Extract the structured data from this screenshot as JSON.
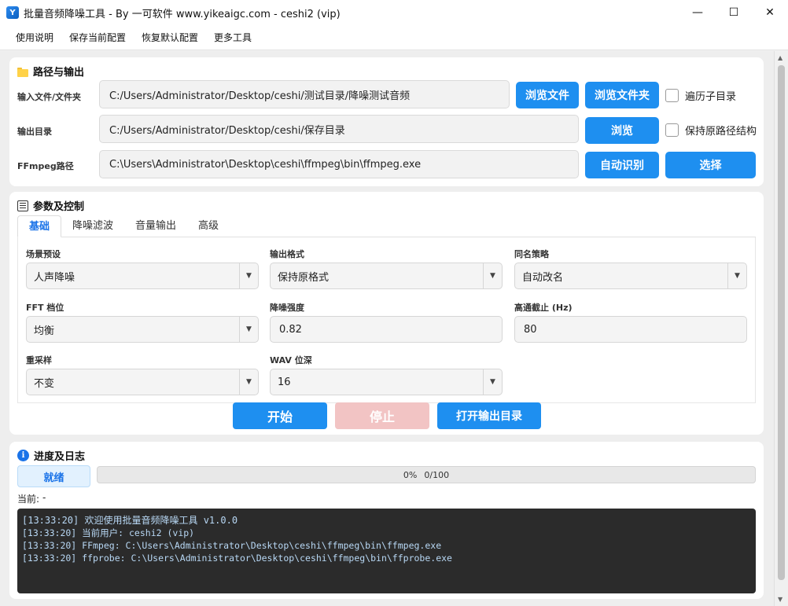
{
  "window": {
    "title": "批量音频降噪工具 - By 一可软件 www.yikeaigc.com - ceshi2 (vip)",
    "app_icon_glyph": "Y",
    "controls": {
      "minimize": "—",
      "maximize": "☐",
      "close": "✕"
    }
  },
  "menu": [
    "使用说明",
    "保存当前配置",
    "恢复默认配置",
    "更多工具"
  ],
  "paths": {
    "title": "路径与输出",
    "input_label": "输入文件/文件夹",
    "input_value": "C:/Users/Administrator/Desktop/ceshi/测试目录/降噪测试音频",
    "browse_file": "浏览文件",
    "browse_folder": "浏览文件夹",
    "recurse_label": "遍历子目录",
    "recurse_checked": false,
    "output_label": "输出目录",
    "output_value": "C:/Users/Administrator/Desktop/ceshi/保存目录",
    "browse": "浏览",
    "keep_structure_label": "保持原路径结构",
    "keep_structure_checked": false,
    "ffmpeg_label": "FFmpeg路径",
    "ffmpeg_value": "C:\\Users\\Administrator\\Desktop\\ceshi\\ffmpeg\\bin\\ffmpeg.exe",
    "auto_detect": "自动识别",
    "select": "选择"
  },
  "params": {
    "title": "参数及控制",
    "tabs": [
      "基础",
      "降噪滤波",
      "音量输出",
      "高级"
    ],
    "active_tab": "基础",
    "fields": {
      "scene_label": "场景预设",
      "scene_value": "人声降噪",
      "format_label": "输出格式",
      "format_value": "保持原格式",
      "naming_label": "同名策略",
      "naming_value": "自动改名",
      "fft_label": "FFT 档位",
      "fft_value": "均衡",
      "strength_label": "降噪强度",
      "strength_value": "0.82",
      "highpass_label": "高通截止 (Hz)",
      "highpass_value": "80",
      "resample_label": "重采样",
      "resample_value": "不变",
      "wav_label": "WAV 位深",
      "wav_value": "16"
    },
    "start": "开始",
    "stop": "停止",
    "open_output": "打开输出目录"
  },
  "progress": {
    "title": "进度及日志",
    "status": "就绪",
    "percent_text": "0%",
    "count_text": "0/100",
    "done": 0,
    "total": 100,
    "current_label": "当前:",
    "current_value": "-"
  },
  "log": [
    "[13:33:20] 欢迎使用批量音频降噪工具 v1.0.0",
    "[13:33:20] 当前用户: ceshi2 (vip)",
    "[13:33:20] FFmpeg: C:\\Users\\Administrator\\Desktop\\ceshi\\ffmpeg\\bin\\ffmpeg.exe",
    "[13:33:20] ffprobe: C:\\Users\\Administrator\\Desktop\\ceshi\\ffmpeg\\bin\\ffprobe.exe"
  ],
  "colors": {
    "accent": "#1e8ff0",
    "stop_disabled": "#f2c4c4",
    "log_bg": "#2b2b2b",
    "log_text": "#b8d8f5"
  },
  "icons": {
    "paths_section": "folder-icon",
    "params_section": "list-icon",
    "progress_section": "info-icon",
    "dropdown": "chevron-down-icon"
  }
}
